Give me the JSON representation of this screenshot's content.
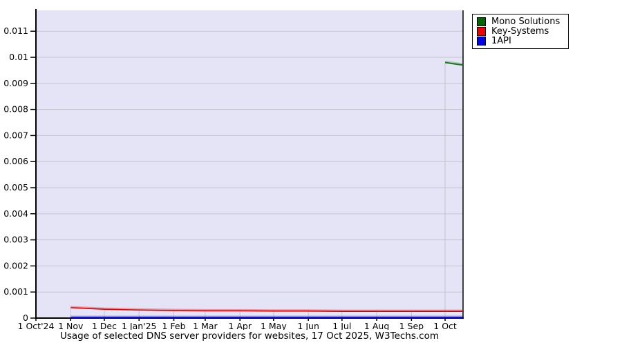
{
  "title": "Usage of selected DNS server providers for websites, 17 Oct 2025, W3Techs.com",
  "legend": {
    "position": "top-right",
    "items": [
      {
        "label": "Mono Solutions",
        "color": "#006600"
      },
      {
        "label": "Key-Systems",
        "color": "#ee0000"
      },
      {
        "label": "1API",
        "color": "#0000ee"
      }
    ]
  },
  "chart_data": {
    "type": "line",
    "title": "Usage of selected DNS server providers for websites, 17 Oct 2025, W3Techs.com",
    "xlabel": "",
    "ylabel": "",
    "grid": true,
    "legend_position": "top-right",
    "plot_background": "#e4e4f6",
    "gridline_color": "#c3c3cd",
    "axis_color": "#000000",
    "x_start": "2024-10-01",
    "x_end": "2025-10-17",
    "ylim": [
      0,
      0.0118
    ],
    "y_ticks": [
      {
        "value": 0,
        "label": "0"
      },
      {
        "value": 0.001,
        "label": "0.001"
      },
      {
        "value": 0.002,
        "label": "0.002"
      },
      {
        "value": 0.003,
        "label": "0.003"
      },
      {
        "value": 0.004,
        "label": "0.004"
      },
      {
        "value": 0.005,
        "label": "0.005"
      },
      {
        "value": 0.006,
        "label": "0.006"
      },
      {
        "value": 0.007,
        "label": "0.007"
      },
      {
        "value": 0.008,
        "label": "0.008"
      },
      {
        "value": 0.009,
        "label": "0.009"
      },
      {
        "value": 0.01,
        "label": "0.01"
      },
      {
        "value": 0.011,
        "label": "0.011"
      }
    ],
    "x_ticks": [
      {
        "date": "2024-10-01",
        "label": "1 Oct'24"
      },
      {
        "date": "2024-11-01",
        "label": "1 Nov"
      },
      {
        "date": "2024-12-01",
        "label": "1 Dec"
      },
      {
        "date": "2025-01-01",
        "label": "1 Jan'25"
      },
      {
        "date": "2025-02-01",
        "label": "1 Feb"
      },
      {
        "date": "2025-03-01",
        "label": "1 Mar"
      },
      {
        "date": "2025-04-01",
        "label": "1 Apr"
      },
      {
        "date": "2025-05-01",
        "label": "1 May"
      },
      {
        "date": "2025-06-01",
        "label": "1 Jun"
      },
      {
        "date": "2025-07-01",
        "label": "1 Jul"
      },
      {
        "date": "2025-08-01",
        "label": "1 Aug"
      },
      {
        "date": "2025-09-01",
        "label": "1 Sep"
      },
      {
        "date": "2025-10-01",
        "label": "1 Oct"
      }
    ],
    "series": [
      {
        "name": "Mono Solutions",
        "color": "#1b7a1b",
        "width": 2,
        "points": [
          {
            "date": "2025-10-01",
            "value": 0.0098
          },
          {
            "date": "2025-10-17",
            "value": 0.0097
          }
        ]
      },
      {
        "name": "Key-Systems",
        "color": "#e00000",
        "width": 1.6,
        "points": [
          {
            "date": "2024-11-01",
            "value": 0.0004
          },
          {
            "date": "2024-12-01",
            "value": 0.00034
          },
          {
            "date": "2025-01-01",
            "value": 0.00031
          },
          {
            "date": "2025-02-01",
            "value": 0.00029
          },
          {
            "date": "2025-03-01",
            "value": 0.00028
          },
          {
            "date": "2025-04-01",
            "value": 0.00028
          },
          {
            "date": "2025-05-01",
            "value": 0.00027
          },
          {
            "date": "2025-06-01",
            "value": 0.00027
          },
          {
            "date": "2025-07-01",
            "value": 0.00026
          },
          {
            "date": "2025-08-01",
            "value": 0.00026
          },
          {
            "date": "2025-09-01",
            "value": 0.00026
          },
          {
            "date": "2025-10-01",
            "value": 0.00026
          },
          {
            "date": "2025-10-17",
            "value": 0.00026
          }
        ]
      },
      {
        "name": "1API",
        "color": "#0000d8",
        "width": 2,
        "points": [
          {
            "date": "2024-11-01",
            "value": 2e-05
          },
          {
            "date": "2025-10-17",
            "value": 2e-05
          }
        ]
      }
    ]
  }
}
